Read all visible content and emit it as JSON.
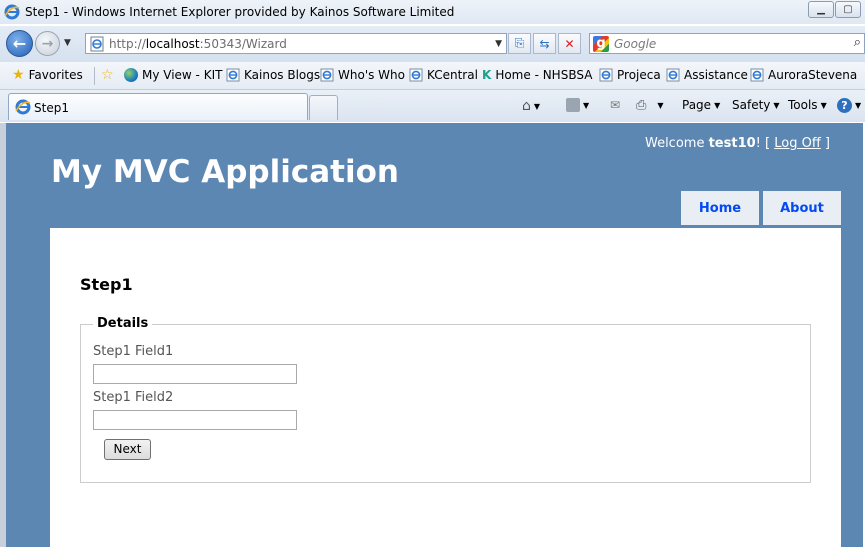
{
  "window": {
    "title": "Step1 - Windows Internet Explorer provided by Kainos Software Limited",
    "controls": [
      "minimize",
      "maximize"
    ]
  },
  "address_bar": {
    "url_prefix": "http://",
    "url_host": "localhost",
    "url_rest": ":50343/Wizard",
    "search_placeholder": "Google"
  },
  "favorites_bar": {
    "favorites_label": "Favorites",
    "items": [
      "My View - KIT",
      "Kainos Blogs",
      "Who's Who",
      "KCentral",
      "Home - NHSBSA",
      "Projeca",
      "Assistance",
      "AuroraStevena"
    ]
  },
  "tabs": {
    "active_tab_label": "Step1"
  },
  "command_bar": {
    "page_label": "Page",
    "safety_label": "Safety",
    "tools_label": "Tools"
  },
  "page": {
    "app_title": "My MVC Application",
    "welcome_prefix": "Welcome",
    "username": "test10",
    "welcome_suffix": "! [",
    "logoff_label": "Log Off",
    "logoff_close": "]",
    "menu": [
      "Home",
      "About"
    ],
    "step_title": "Step1",
    "fieldset_legend": "Details",
    "field1_label": "Step1 Field1",
    "field1_value": "",
    "field2_label": "Step1 Field2",
    "field2_value": "",
    "next_label": "Next"
  },
  "colors": {
    "page_background": "#5c87b2",
    "menu_tab": "#e8eef4",
    "menu_text": "#034af3"
  }
}
